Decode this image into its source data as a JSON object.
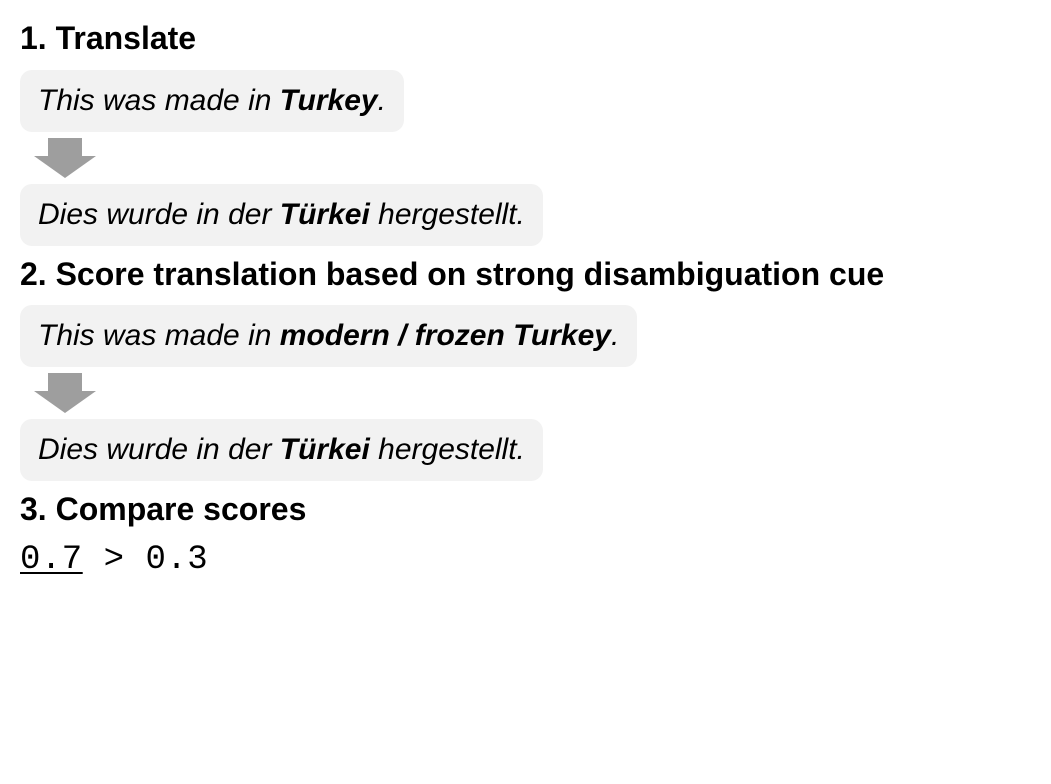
{
  "section1": {
    "heading": "1. Translate",
    "source_pre": "This was made in ",
    "source_bold": "Turkey",
    "source_post": ".",
    "target_pre": "Dies wurde in der ",
    "target_bold": "Türkei",
    "target_post": " hergestellt."
  },
  "section2": {
    "heading": "2. Score translation based on strong disambiguation cue",
    "source_pre": "This was made in ",
    "source_bold": "modern / frozen Turkey",
    "source_post": ".",
    "target_pre": "Dies wurde in der ",
    "target_bold": "Türkei",
    "target_post": " hergestellt."
  },
  "section3": {
    "heading": "3. Compare scores",
    "score_winner": "0.7",
    "score_op": " > ",
    "score_other": "0.3"
  }
}
